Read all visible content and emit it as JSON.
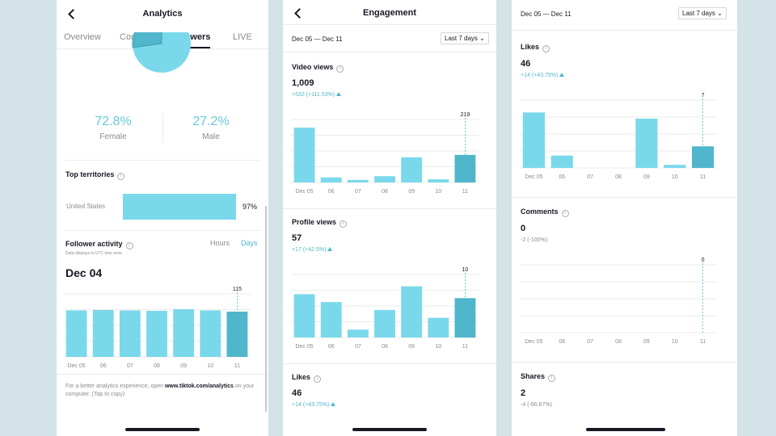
{
  "colors": {
    "bar": "#7ad8eb",
    "bar_active": "#4fb6cb",
    "grid": "#ebebeb",
    "pie_female": "#7ad8eb",
    "pie_male": "#4fb6cb"
  },
  "followers_screen": {
    "title": "Analytics",
    "tabs": [
      "Overview",
      "Content",
      "Followers",
      "LIVE"
    ],
    "active_tab": "Followers",
    "female_pct": "72.8%",
    "female_label": "Female",
    "male_pct": "27.2%",
    "male_label": "Male",
    "top_territories_title": "Top territories",
    "territory_name": "United States",
    "territory_pct": "97%",
    "territory_value": 0.97,
    "follower_activity_title": "Follower activity",
    "toggle_hours": "Hours",
    "toggle_days": "Days",
    "utc_note": "Data displays in UTC time zone",
    "selected_date": "Dec 04",
    "footer_prefix": "For a better analytics experience, open",
    "footer_link": "www.tiktok.com/analytics",
    "footer_suffix": "on your computer. (Tap to copy)"
  },
  "engagement_screen": {
    "title": "Engagement",
    "date_range": "Dec 05 — Dec 11",
    "range_select": "Last 7 days",
    "video_views": {
      "title": "Video views",
      "value": "1,009",
      "delta": "+532 (+111.53%)"
    },
    "profile_views": {
      "title": "Profile views",
      "value": "57",
      "delta": "+17 (+42.5%)"
    },
    "likes": {
      "title": "Likes",
      "value": "46",
      "delta": "+14 (+43.75%)"
    }
  },
  "engagement_screen_scrolled": {
    "date_range": "Dec 05 — Dec 11",
    "range_select": "Last 7 days",
    "likes": {
      "title": "Likes",
      "value": "46",
      "delta": "+14 (+43.75%)"
    },
    "comments": {
      "title": "Comments",
      "value": "0",
      "delta": "-2 (-100%)"
    },
    "shares": {
      "title": "Shares",
      "value": "2",
      "delta": "-4 (-66.67%)"
    }
  },
  "chart_data": [
    {
      "id": "gender_split",
      "type": "pie",
      "categories": [
        "Female",
        "Male"
      ],
      "values": [
        72.8,
        27.2
      ]
    },
    {
      "id": "follower_activity",
      "type": "bar",
      "categories": [
        "Dec 05",
        "06",
        "07",
        "08",
        "09",
        "10",
        "11"
      ],
      "values": [
        118,
        119,
        118,
        117,
        121,
        118,
        115
      ],
      "highlight_label": "115",
      "highlight_index": 6,
      "ylim": [
        0,
        160
      ]
    },
    {
      "id": "video_views",
      "type": "bar",
      "categories": [
        "Dec 05",
        "06",
        "07",
        "08",
        "09",
        "10",
        "11"
      ],
      "values": [
        435,
        40,
        20,
        50,
        200,
        25,
        219
      ],
      "highlight_label": "219",
      "highlight_index": 6,
      "ylim": [
        0,
        500
      ]
    },
    {
      "id": "profile_views",
      "type": "bar",
      "categories": [
        "Dec 05",
        "06",
        "07",
        "08",
        "09",
        "10",
        "11"
      ],
      "values": [
        11,
        9,
        2,
        7,
        13,
        5,
        10
      ],
      "highlight_label": "10",
      "highlight_index": 6,
      "ylim": [
        0,
        16
      ]
    },
    {
      "id": "likes",
      "type": "bar",
      "categories": [
        "Dec 05",
        "06",
        "07",
        "08",
        "09",
        "10",
        "11"
      ],
      "values": [
        18,
        4,
        0,
        0,
        16,
        1,
        7
      ],
      "highlight_label": "7",
      "highlight_index": 6,
      "ylim": [
        0,
        22
      ]
    },
    {
      "id": "comments",
      "type": "bar",
      "categories": [
        "Dec 05",
        "06",
        "07",
        "08",
        "09",
        "10",
        "11"
      ],
      "values": [
        0,
        0,
        0,
        0,
        0,
        0,
        0
      ],
      "highlight_label": "0",
      "highlight_index": 6,
      "ylim": [
        0,
        4
      ]
    }
  ]
}
